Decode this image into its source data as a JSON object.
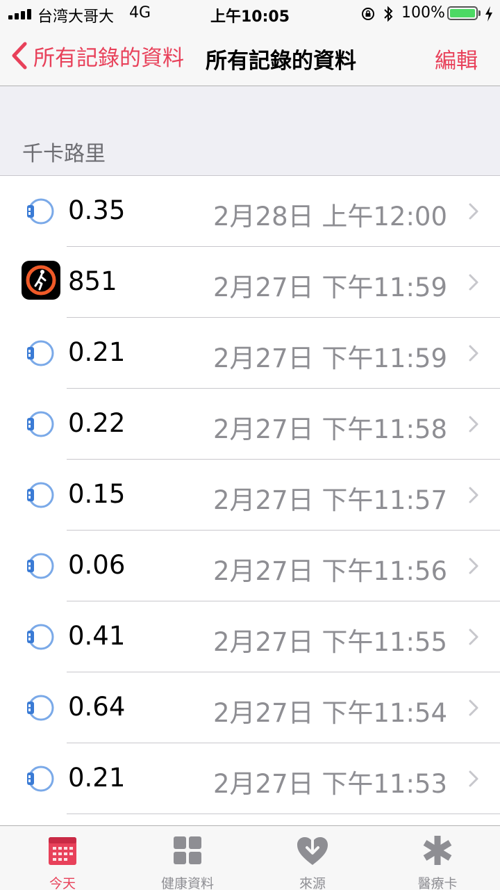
{
  "status_bar": {
    "carrier": "台湾大哥大",
    "network": "4G",
    "time": "上午10:05",
    "battery": "100%"
  },
  "nav": {
    "back_label": "所有記錄的資料",
    "title": "所有記錄的資料",
    "edit_label": "編輯"
  },
  "section": {
    "title": "千卡路里"
  },
  "records": [
    {
      "value": "0.35",
      "date": "2月28日 上午12:00",
      "source": "watch-icon"
    },
    {
      "value": "851",
      "date": "2月27日 下午11:59",
      "source": "workout-app-icon"
    },
    {
      "value": "0.21",
      "date": "2月27日 下午11:59",
      "source": "watch-icon"
    },
    {
      "value": "0.22",
      "date": "2月27日 下午11:58",
      "source": "watch-icon"
    },
    {
      "value": "0.15",
      "date": "2月27日 下午11:57",
      "source": "watch-icon"
    },
    {
      "value": "0.06",
      "date": "2月27日 下午11:56",
      "source": "watch-icon"
    },
    {
      "value": "0.41",
      "date": "2月27日 下午11:55",
      "source": "watch-icon"
    },
    {
      "value": "0.64",
      "date": "2月27日 下午11:54",
      "source": "watch-icon"
    },
    {
      "value": "0.21",
      "date": "2月27日 下午11:53",
      "source": "watch-icon"
    }
  ],
  "tabs": [
    {
      "label": "今天",
      "icon": "calendar-icon",
      "active": true
    },
    {
      "label": "健康資料",
      "icon": "grid-icon",
      "active": false
    },
    {
      "label": "來源",
      "icon": "heart-download-icon",
      "active": false
    },
    {
      "label": "醫療卡",
      "icon": "asterisk-icon",
      "active": false
    }
  ],
  "colors": {
    "accent": "#e8415a",
    "secondary_text": "#8e8e93",
    "watch_blue": "#3a7bd5",
    "battery_green": "#4cd964"
  }
}
